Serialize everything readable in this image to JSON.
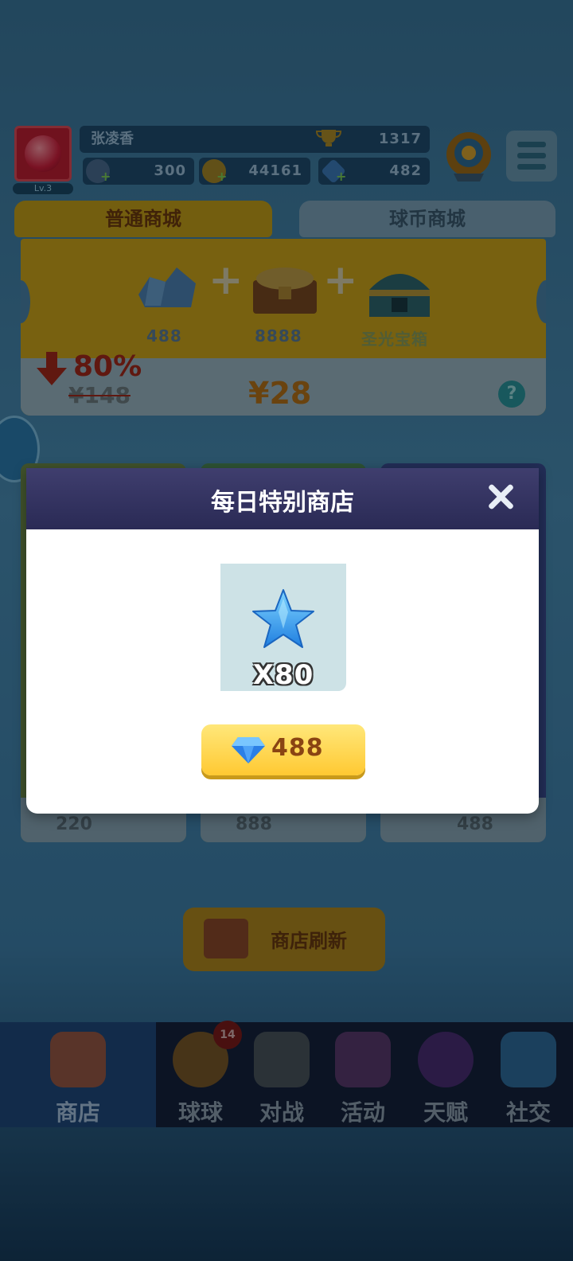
{
  "player": {
    "name": "张凌香",
    "level": "Lv.3",
    "trophies": "1317"
  },
  "currencies": [
    {
      "icon": "energy-icon",
      "value": "300"
    },
    {
      "icon": "coin-icon",
      "value": "44161"
    },
    {
      "icon": "gem-icon",
      "value": "482"
    }
  ],
  "tabs": [
    "普通商城",
    "球币商城"
  ],
  "banner": {
    "items": [
      {
        "icon": "gem-pile-icon",
        "label": "488"
      },
      {
        "icon": "gold-chest-icon",
        "label": "8888"
      },
      {
        "icon": "holy-chest-icon",
        "label": "圣光宝箱"
      }
    ],
    "discount": "80%",
    "old_price": "¥148",
    "new_price": "¥28"
  },
  "cards": [
    {
      "price": "220"
    },
    {
      "price": "888"
    },
    {
      "price": "488"
    }
  ],
  "refresh_label": "商店刷新",
  "nav": [
    {
      "label": "商店",
      "icon": "shop-icon",
      "active": true
    },
    {
      "label": "球球",
      "icon": "ball-icon",
      "badge": "14"
    },
    {
      "label": "对战",
      "icon": "swords-icon"
    },
    {
      "label": "活动",
      "icon": "party-icon"
    },
    {
      "label": "天赋",
      "icon": "planet-icon"
    },
    {
      "label": "社交",
      "icon": "chat-icon"
    }
  ],
  "dialog": {
    "title": "每日特别商店",
    "reward": {
      "icon": "blue-star-icon",
      "quantity": "X80"
    },
    "buy": {
      "icon": "diamond-icon",
      "price": "488"
    }
  },
  "colors": {
    "accent": "#ffc932",
    "dialog_header": "#2f2f5c",
    "price_text": "#8a4413"
  }
}
